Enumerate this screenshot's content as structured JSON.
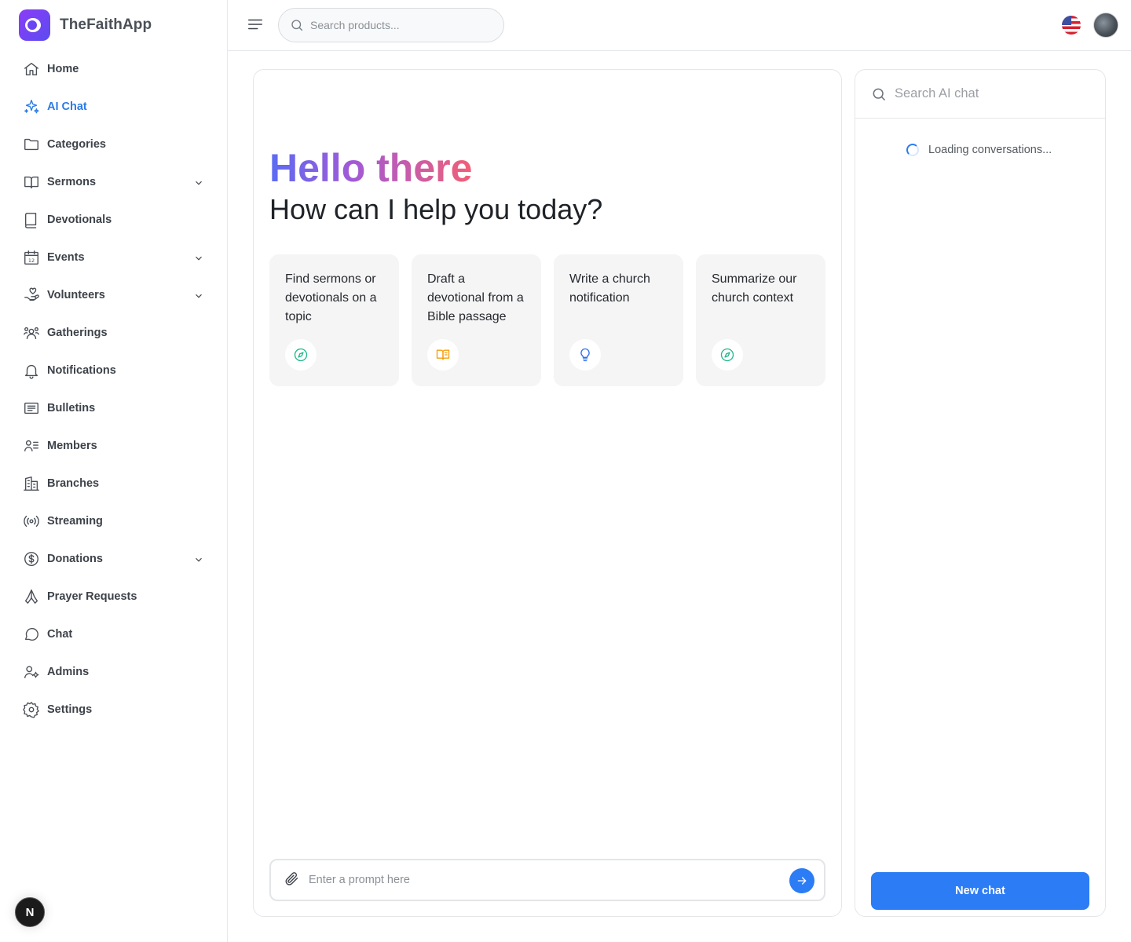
{
  "brand": {
    "name": "TheFaithApp"
  },
  "header": {
    "search_placeholder": "Search products..."
  },
  "sidebar": {
    "items": [
      {
        "label": "Home",
        "icon": "home-icon",
        "active": false,
        "expandable": false
      },
      {
        "label": "AI Chat",
        "icon": "sparkles-icon",
        "active": true,
        "expandable": false
      },
      {
        "label": "Categories",
        "icon": "folder-icon",
        "active": false,
        "expandable": false
      },
      {
        "label": "Sermons",
        "icon": "book-open-icon",
        "active": false,
        "expandable": true
      },
      {
        "label": "Devotionals",
        "icon": "book-icon",
        "active": false,
        "expandable": false
      },
      {
        "label": "Events",
        "icon": "calendar-icon",
        "active": false,
        "expandable": true
      },
      {
        "label": "Volunteers",
        "icon": "hand-heart-icon",
        "active": false,
        "expandable": true
      },
      {
        "label": "Gatherings",
        "icon": "users-icon",
        "active": false,
        "expandable": false
      },
      {
        "label": "Notifications",
        "icon": "bell-icon",
        "active": false,
        "expandable": false
      },
      {
        "label": "Bulletins",
        "icon": "newspaper-icon",
        "active": false,
        "expandable": false
      },
      {
        "label": "Members",
        "icon": "user-list-icon",
        "active": false,
        "expandable": false
      },
      {
        "label": "Branches",
        "icon": "building-icon",
        "active": false,
        "expandable": false
      },
      {
        "label": "Streaming",
        "icon": "broadcast-icon",
        "active": false,
        "expandable": false
      },
      {
        "label": "Donations",
        "icon": "dollar-circle-icon",
        "active": false,
        "expandable": true
      },
      {
        "label": "Prayer Requests",
        "icon": "praying-hands-icon",
        "active": false,
        "expandable": false
      },
      {
        "label": "Chat",
        "icon": "chat-bubble-icon",
        "active": false,
        "expandable": false
      },
      {
        "label": "Admins",
        "icon": "user-gear-icon",
        "active": false,
        "expandable": false
      },
      {
        "label": "Settings",
        "icon": "gear-icon",
        "active": false,
        "expandable": false
      }
    ],
    "badge_letter": "N"
  },
  "chat": {
    "greeting": "Hello there",
    "subtitle": "How can I help you today?",
    "suggestions": [
      {
        "text": "Find sermons or devotionals on a topic",
        "icon": "compass-icon",
        "color": "#1fb88a"
      },
      {
        "text": "Draft a devotional from a Bible passage",
        "icon": "open-book-icon",
        "color": "#f59e0b"
      },
      {
        "text": "Write a church notification",
        "icon": "lightbulb-icon",
        "color": "#2b6ef2"
      },
      {
        "text": "Summarize our church context",
        "icon": "compass-icon",
        "color": "#1fb88a"
      }
    ],
    "prompt_placeholder": "Enter a prompt here"
  },
  "history": {
    "search_placeholder": "Search AI chat",
    "loading_text": "Loading conversations...",
    "new_chat_label": "New chat"
  },
  "colors": {
    "accent": "#2b7cf5",
    "brand": "#6b44f3"
  }
}
